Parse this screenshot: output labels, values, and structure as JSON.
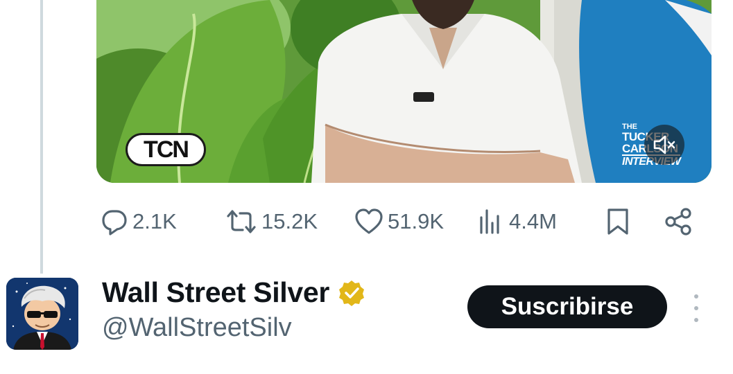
{
  "media": {
    "watermark_left": "TCN",
    "watermark_right": [
      "THE",
      "TUCKER",
      "CARLSON",
      "INTERVIEW"
    ],
    "mute_icon": "speaker-muted-icon"
  },
  "actions": {
    "replies": "2.1K",
    "reposts": "15.2K",
    "likes": "51.9K",
    "views": "4.4M",
    "icons": [
      "reply-icon",
      "repost-icon",
      "like-icon",
      "views-icon",
      "bookmark-icon",
      "share-icon"
    ]
  },
  "profile": {
    "display_name": "Wall Street Silver",
    "handle": "@WallStreetSilv",
    "verified_badge": "gold-verified-icon",
    "subscribe_label": "Suscribirse",
    "more_icon": "more-vertical-icon"
  },
  "colors": {
    "text_primary": "#0f1419",
    "text_secondary": "#536471",
    "verified_gold": "#e2b719",
    "button_bg": "#0f1419"
  }
}
